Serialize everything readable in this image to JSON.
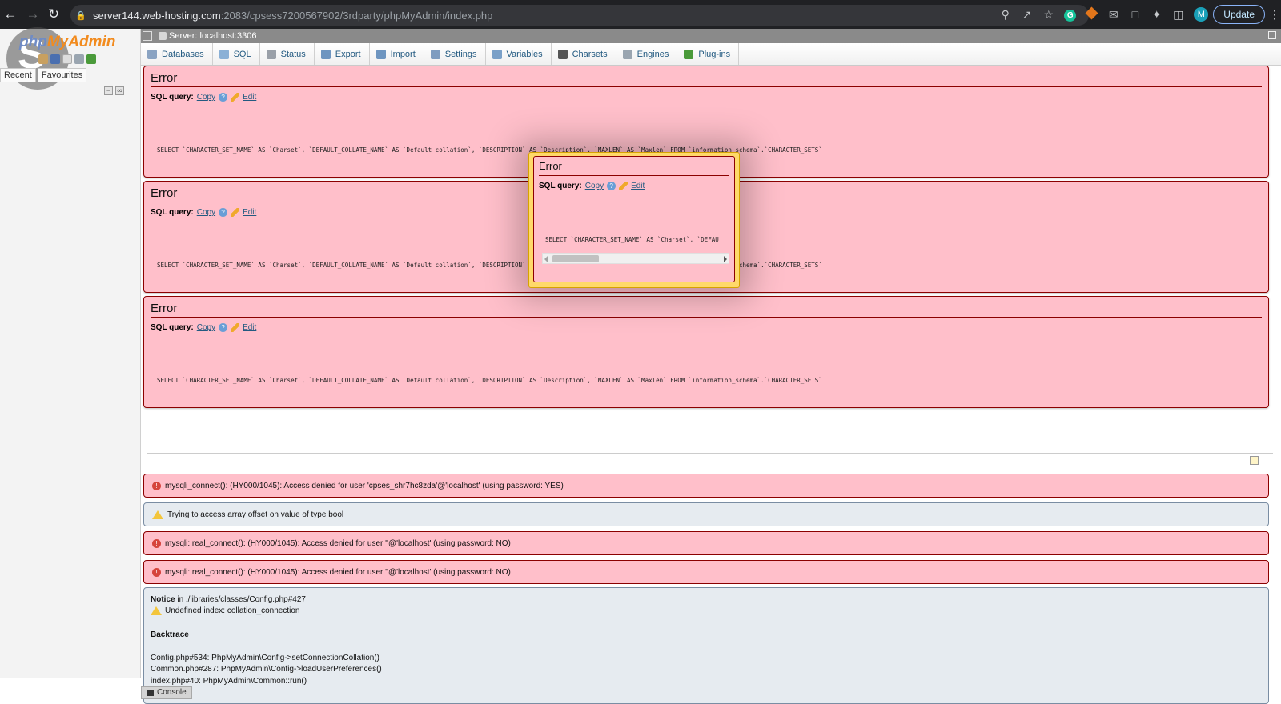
{
  "browser": {
    "url_host": "server144.web-hosting.com",
    "url_path": ":2083/cpsess7200567902/3rdparty/phpMyAdmin/index.php",
    "profile_initial": "M",
    "update_label": "Update"
  },
  "sidebar": {
    "logo": "phpMyAdmin",
    "recent_label": "Recent",
    "favourites_label": "Favourites"
  },
  "server_bar": {
    "label": "Server: localhost:3306"
  },
  "topmenu": [
    {
      "label": "Databases",
      "icon": "database-icon",
      "color": "#8aa3c2"
    },
    {
      "label": "SQL",
      "icon": "sql-icon",
      "color": "#8ab0d6"
    },
    {
      "label": "Status",
      "icon": "status-icon",
      "color": "#9aa0a8"
    },
    {
      "label": "Export",
      "icon": "export-icon",
      "color": "#6e95c0"
    },
    {
      "label": "Import",
      "icon": "import-icon",
      "color": "#6e95c0"
    },
    {
      "label": "Settings",
      "icon": "wrench-icon",
      "color": "#7e9cc0"
    },
    {
      "label": "Variables",
      "icon": "variables-icon",
      "color": "#7aa0c8"
    },
    {
      "label": "Charsets",
      "icon": "charsets-icon",
      "color": "#555555"
    },
    {
      "label": "Engines",
      "icon": "engines-icon",
      "color": "#9aa5b0"
    },
    {
      "label": "Plug-ins",
      "icon": "puzzle-icon",
      "color": "#4a9a3a"
    }
  ],
  "errors": {
    "title": "Error",
    "sql_query_label": "SQL query:",
    "copy_label": "Copy",
    "edit_label": "Edit",
    "query_full": "SELECT `CHARACTER_SET_NAME` AS `Charset`, `DEFAULT_COLLATE_NAME` AS `Default collation`, `DESCRIPTION` AS `Description`, `MAXLEN` AS `Maxlen` FROM `information_schema`.`CHARACTER_SETS`",
    "query_1": "SELECT `CHARACTER_SET_NAME` AS `Charset`, `DEFAULT_COLLATE_NAME` AS `Default collation`, `DESCRIPTION` AS `Description`, `MAXLEN` AS `Maxlen` FROM `information_schema`.`CHARACTER_SETS`",
    "query_2": "SELECT `CHARACTER_SET_NAME` AS `Charset`, `DEFAULT_COLLATE_NAME` AS `Default collation`, `DESCRIPTION` AS `Description`, `MAXLEN` AS `Maxlen` FROM `information_schema`.`CHARACTER_SETS`",
    "popup_query": "SELECT `CHARACTER_SET_NAME` AS `Charset`, `DEFAU"
  },
  "messages": [
    {
      "type": "error",
      "text": "mysqli_connect(): (HY000/1045): Access denied for user 'cpses_shr7hc8zda'@'localhost' (using password: YES)"
    },
    {
      "type": "notice",
      "text": "Trying to access array offset on value of type bool"
    },
    {
      "type": "error",
      "text": "mysqli::real_connect(): (HY000/1045): Access denied for user ''@'localhost' (using password: NO)"
    },
    {
      "type": "error",
      "text": "mysqli::real_connect(): (HY000/1045): Access denied for user ''@'localhost' (using password: NO)"
    }
  ],
  "notice_block": {
    "notice_label": "Notice",
    "notice_location": " in ./libraries/classes/Config.php#427",
    "warning_text": "Undefined index: collation_connection",
    "backtrace_label": "Backtrace",
    "trace_1": "Config.php#534: PhpMyAdmin\\Config->setConnectionCollation()",
    "trace_2": "Common.php#287: PhpMyAdmin\\Config->loadUserPreferences()",
    "trace_3": "index.php#40: PhpMyAdmin\\Common::run()"
  },
  "console": {
    "label": "Console"
  }
}
